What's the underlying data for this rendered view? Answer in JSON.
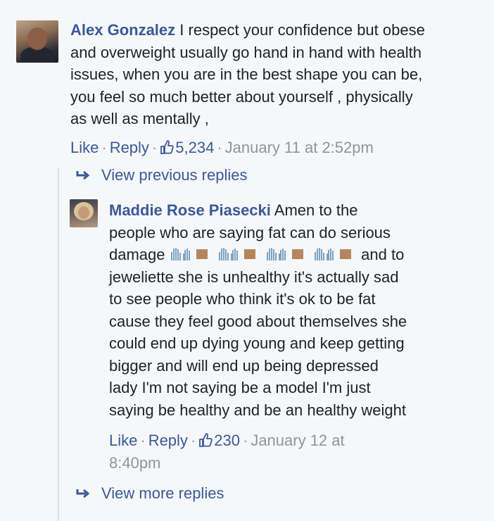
{
  "comment1": {
    "author": "Alex Gonzalez",
    "text_lines": [
      "I respect your confidence but obese",
      "and overweight usually go hand in hand with health",
      "issues, when you are in the best shape you can be,",
      "you feel so much better about yourself , physically",
      "as well as mentally ,"
    ],
    "like_label": "Like",
    "reply_label": "Reply",
    "like_count": "5,234",
    "timestamp": "January 11 at 2:52pm"
  },
  "view_previous_label": "View previous replies",
  "comment2": {
    "author": "Maddie Rose Piasecki",
    "text_lines": [
      "Amen to the",
      "people who are saying fat can do serious",
      "damage",
      "and to",
      "jeweliette she is unhealthy it's actually sad",
      "to see people who think it's ok to be fat",
      "cause they feel good about themselves she",
      "could end up dying young and keep getting",
      "bigger and will end up being depressed",
      "lady I'm not saying be a model I'm just",
      "saying be healthy and be an healthy weight"
    ],
    "emoji_names": [
      "raising-hands-icon",
      "raising-hands-icon",
      "raising-hands-icon",
      "raising-hands-icon"
    ],
    "like_label": "Like",
    "reply_label": "Reply",
    "like_count": "230",
    "timestamp_line1": "January 12 at",
    "timestamp_line2": "8:40pm"
  },
  "view_more_label": "View more replies",
  "colors": {
    "link": "#3b5998",
    "meta": "#90949c",
    "text": "#1d2129",
    "background": "#f6f7f9"
  }
}
